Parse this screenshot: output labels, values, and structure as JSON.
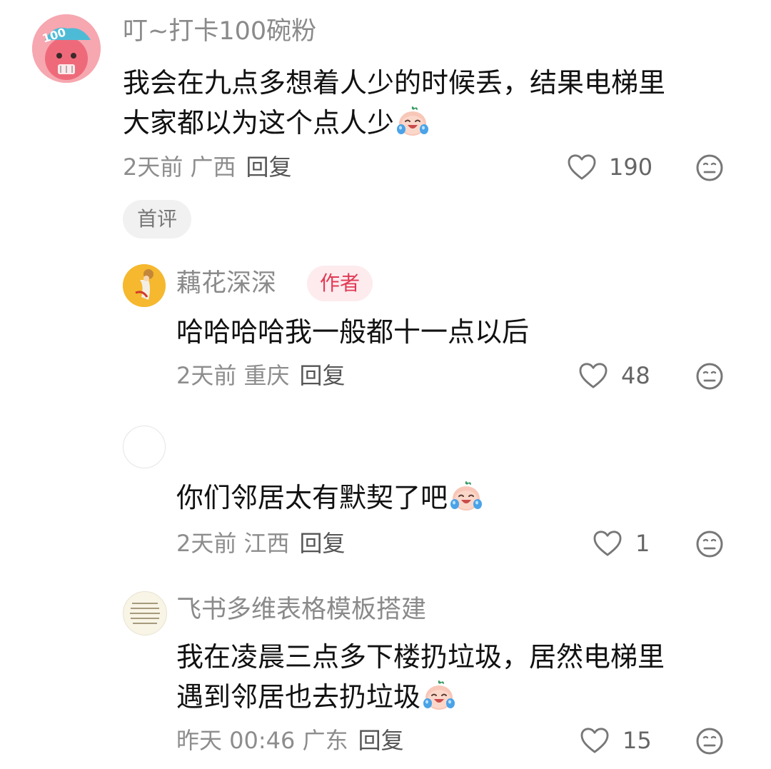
{
  "colors": {
    "author_badge": "#e23a55",
    "text": "#111111",
    "meta": "#8d8d8d"
  },
  "emoji_name": "crying-laughing-peach-emoji",
  "comments": [
    {
      "username": "叮~打卡100碗粉",
      "text_line1": "我会在九点多想着人少的时候丢，结果电梯里",
      "text_line2": "大家都以为这个点人少",
      "time_location": "2天前 广西",
      "reply_label": "回复",
      "likes": "190",
      "tag": "首评",
      "avatar_text": "100"
    },
    {
      "username": "藕花深深",
      "badge": "作者",
      "text": "哈哈哈哈我一般都十一点以后",
      "time_location": "2天前 重庆",
      "reply_label": "回复",
      "likes": "48"
    },
    {
      "username": "",
      "text": "你们邻居太有默契了吧",
      "time_location": "2天前 江西",
      "reply_label": "回复",
      "likes": "1"
    },
    {
      "username": "飞书多维表格模板搭建",
      "text_line1": "我在凌晨三点多下楼扔垃圾，居然电梯里",
      "text_line2": "遇到邻居也去扔垃圾",
      "time_location": "昨天 00:46 广东",
      "reply_label": "回复",
      "likes": "15"
    }
  ]
}
